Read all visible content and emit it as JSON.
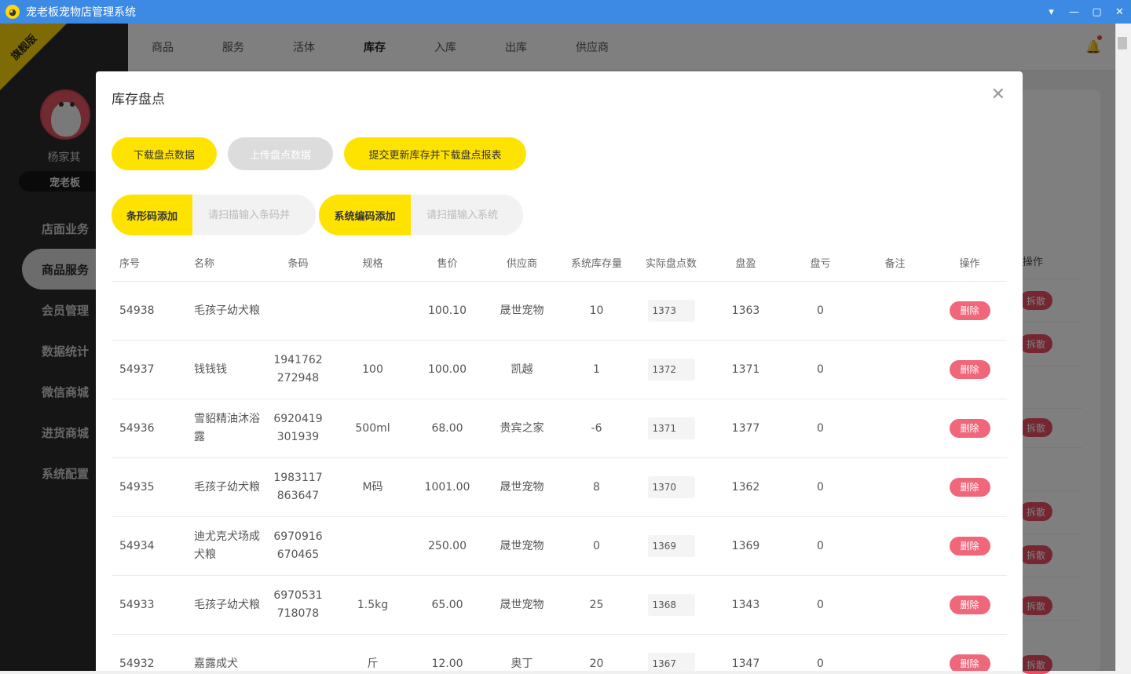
{
  "app": {
    "title": "宠老板宠物店管理系统"
  },
  "sidebar": {
    "ribbon": "旗舰版",
    "user_name": "杨家其",
    "shop": "宠老板",
    "items": [
      {
        "label": "店面业务"
      },
      {
        "label": "商品服务"
      },
      {
        "label": "会员管理"
      },
      {
        "label": "数据统计"
      },
      {
        "label": "微信商城"
      },
      {
        "label": "进货商城"
      },
      {
        "label": "系统配置"
      }
    ]
  },
  "topnav": {
    "tabs": [
      "商品",
      "服务",
      "活体",
      "库存",
      "入库",
      "出库",
      "供应商"
    ]
  },
  "background": {
    "op_header": "操作",
    "split_label": "拆散"
  },
  "dialog": {
    "title": "库存盘点",
    "buttons": {
      "download": "下载盘点数据",
      "upload": "上传盘点数据",
      "submit": "提交更新库存并下载盘点报表"
    },
    "barcode_add": {
      "label": "条形码添加",
      "placeholder": "请扫描输入条码并"
    },
    "syscode_add": {
      "label": "系统编码添加",
      "placeholder": "请扫描输入系统"
    },
    "table": {
      "headers": [
        "序号",
        "名称",
        "条码",
        "规格",
        "售价",
        "供应商",
        "系统库存量",
        "实际盘点数",
        "盘盈",
        "盘亏",
        "备注",
        "操作"
      ],
      "delete_label": "删除",
      "rows": [
        {
          "seq": "54938",
          "name": "毛孩子幼犬粮",
          "barcode": "",
          "spec": "",
          "price": "100.10",
          "supplier": "晟世宠物",
          "stock": "10",
          "actual": "1373",
          "gain": "1363",
          "loss": "0",
          "note": ""
        },
        {
          "seq": "54937",
          "name": "钱钱钱",
          "barcode": "1941762272948",
          "spec": "100",
          "price": "100.00",
          "supplier": "凯越",
          "stock": "1",
          "actual": "1372",
          "gain": "1371",
          "loss": "0",
          "note": ""
        },
        {
          "seq": "54936",
          "name": "雪貂精油沐浴露",
          "barcode": "6920419301939",
          "spec": "500ml",
          "price": "68.00",
          "supplier": "贵宾之家",
          "stock": "-6",
          "actual": "1371",
          "gain": "1377",
          "loss": "0",
          "note": ""
        },
        {
          "seq": "54935",
          "name": "毛孩子幼犬粮",
          "barcode": "1983117863647",
          "spec": "M码",
          "price": "1001.00",
          "supplier": "晟世宠物",
          "stock": "8",
          "actual": "1370",
          "gain": "1362",
          "loss": "0",
          "note": ""
        },
        {
          "seq": "54934",
          "name": "迪尤克犬场成犬粮",
          "barcode": "6970916670465",
          "spec": "",
          "price": "250.00",
          "supplier": "晟世宠物",
          "stock": "0",
          "actual": "1369",
          "gain": "1369",
          "loss": "0",
          "note": ""
        },
        {
          "seq": "54933",
          "name": "毛孩子幼犬粮",
          "barcode": "6970531718078",
          "spec": "1.5kg",
          "price": "65.00",
          "supplier": "晟世宠物",
          "stock": "25",
          "actual": "1368",
          "gain": "1343",
          "loss": "0",
          "note": ""
        },
        {
          "seq": "54932",
          "name": "嘉露成犬",
          "barcode": "",
          "spec": "斤",
          "price": "12.00",
          "supplier": "奥丁",
          "stock": "20",
          "actual": "1367",
          "gain": "1347",
          "loss": "0",
          "note": ""
        }
      ]
    }
  }
}
